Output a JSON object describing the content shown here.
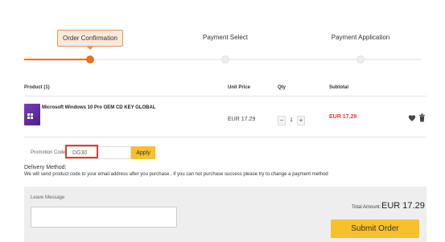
{
  "steps": [
    {
      "label": "Order Confirmation",
      "active": true
    },
    {
      "label": "Payment Select",
      "active": false
    },
    {
      "label": "Payment Application",
      "active": false
    }
  ],
  "table": {
    "headers": {
      "product": "Product (1)",
      "unit_price": "Unit Price",
      "qty": "Qty",
      "subtotal": "Subtotal"
    }
  },
  "product": {
    "name": "Microsoft Windows 10 Pro OEM CD KEY GLOBAL",
    "unit_price": "EUR 17.29",
    "quantity": "1",
    "minus": "−",
    "plus": "+",
    "subtotal": "EUR 17.29",
    "subtotal_color": "#e53935"
  },
  "promo": {
    "label": "Promotion Code",
    "value": "DG30",
    "apply_label": "Apply"
  },
  "delivery": {
    "title": "Delivery Method:",
    "text": "We will send product code to your email address after you purchase , if you can not purchase success please try to change a payment method"
  },
  "message": {
    "label": "Leave Message",
    "value": ""
  },
  "total": {
    "label": "Total Amount:",
    "value": "EUR 17.29"
  },
  "submit_label": "Submit Order",
  "colors": {
    "accent": "#e8701e",
    "button": "#f6c12a",
    "highlight": "#e53935"
  }
}
